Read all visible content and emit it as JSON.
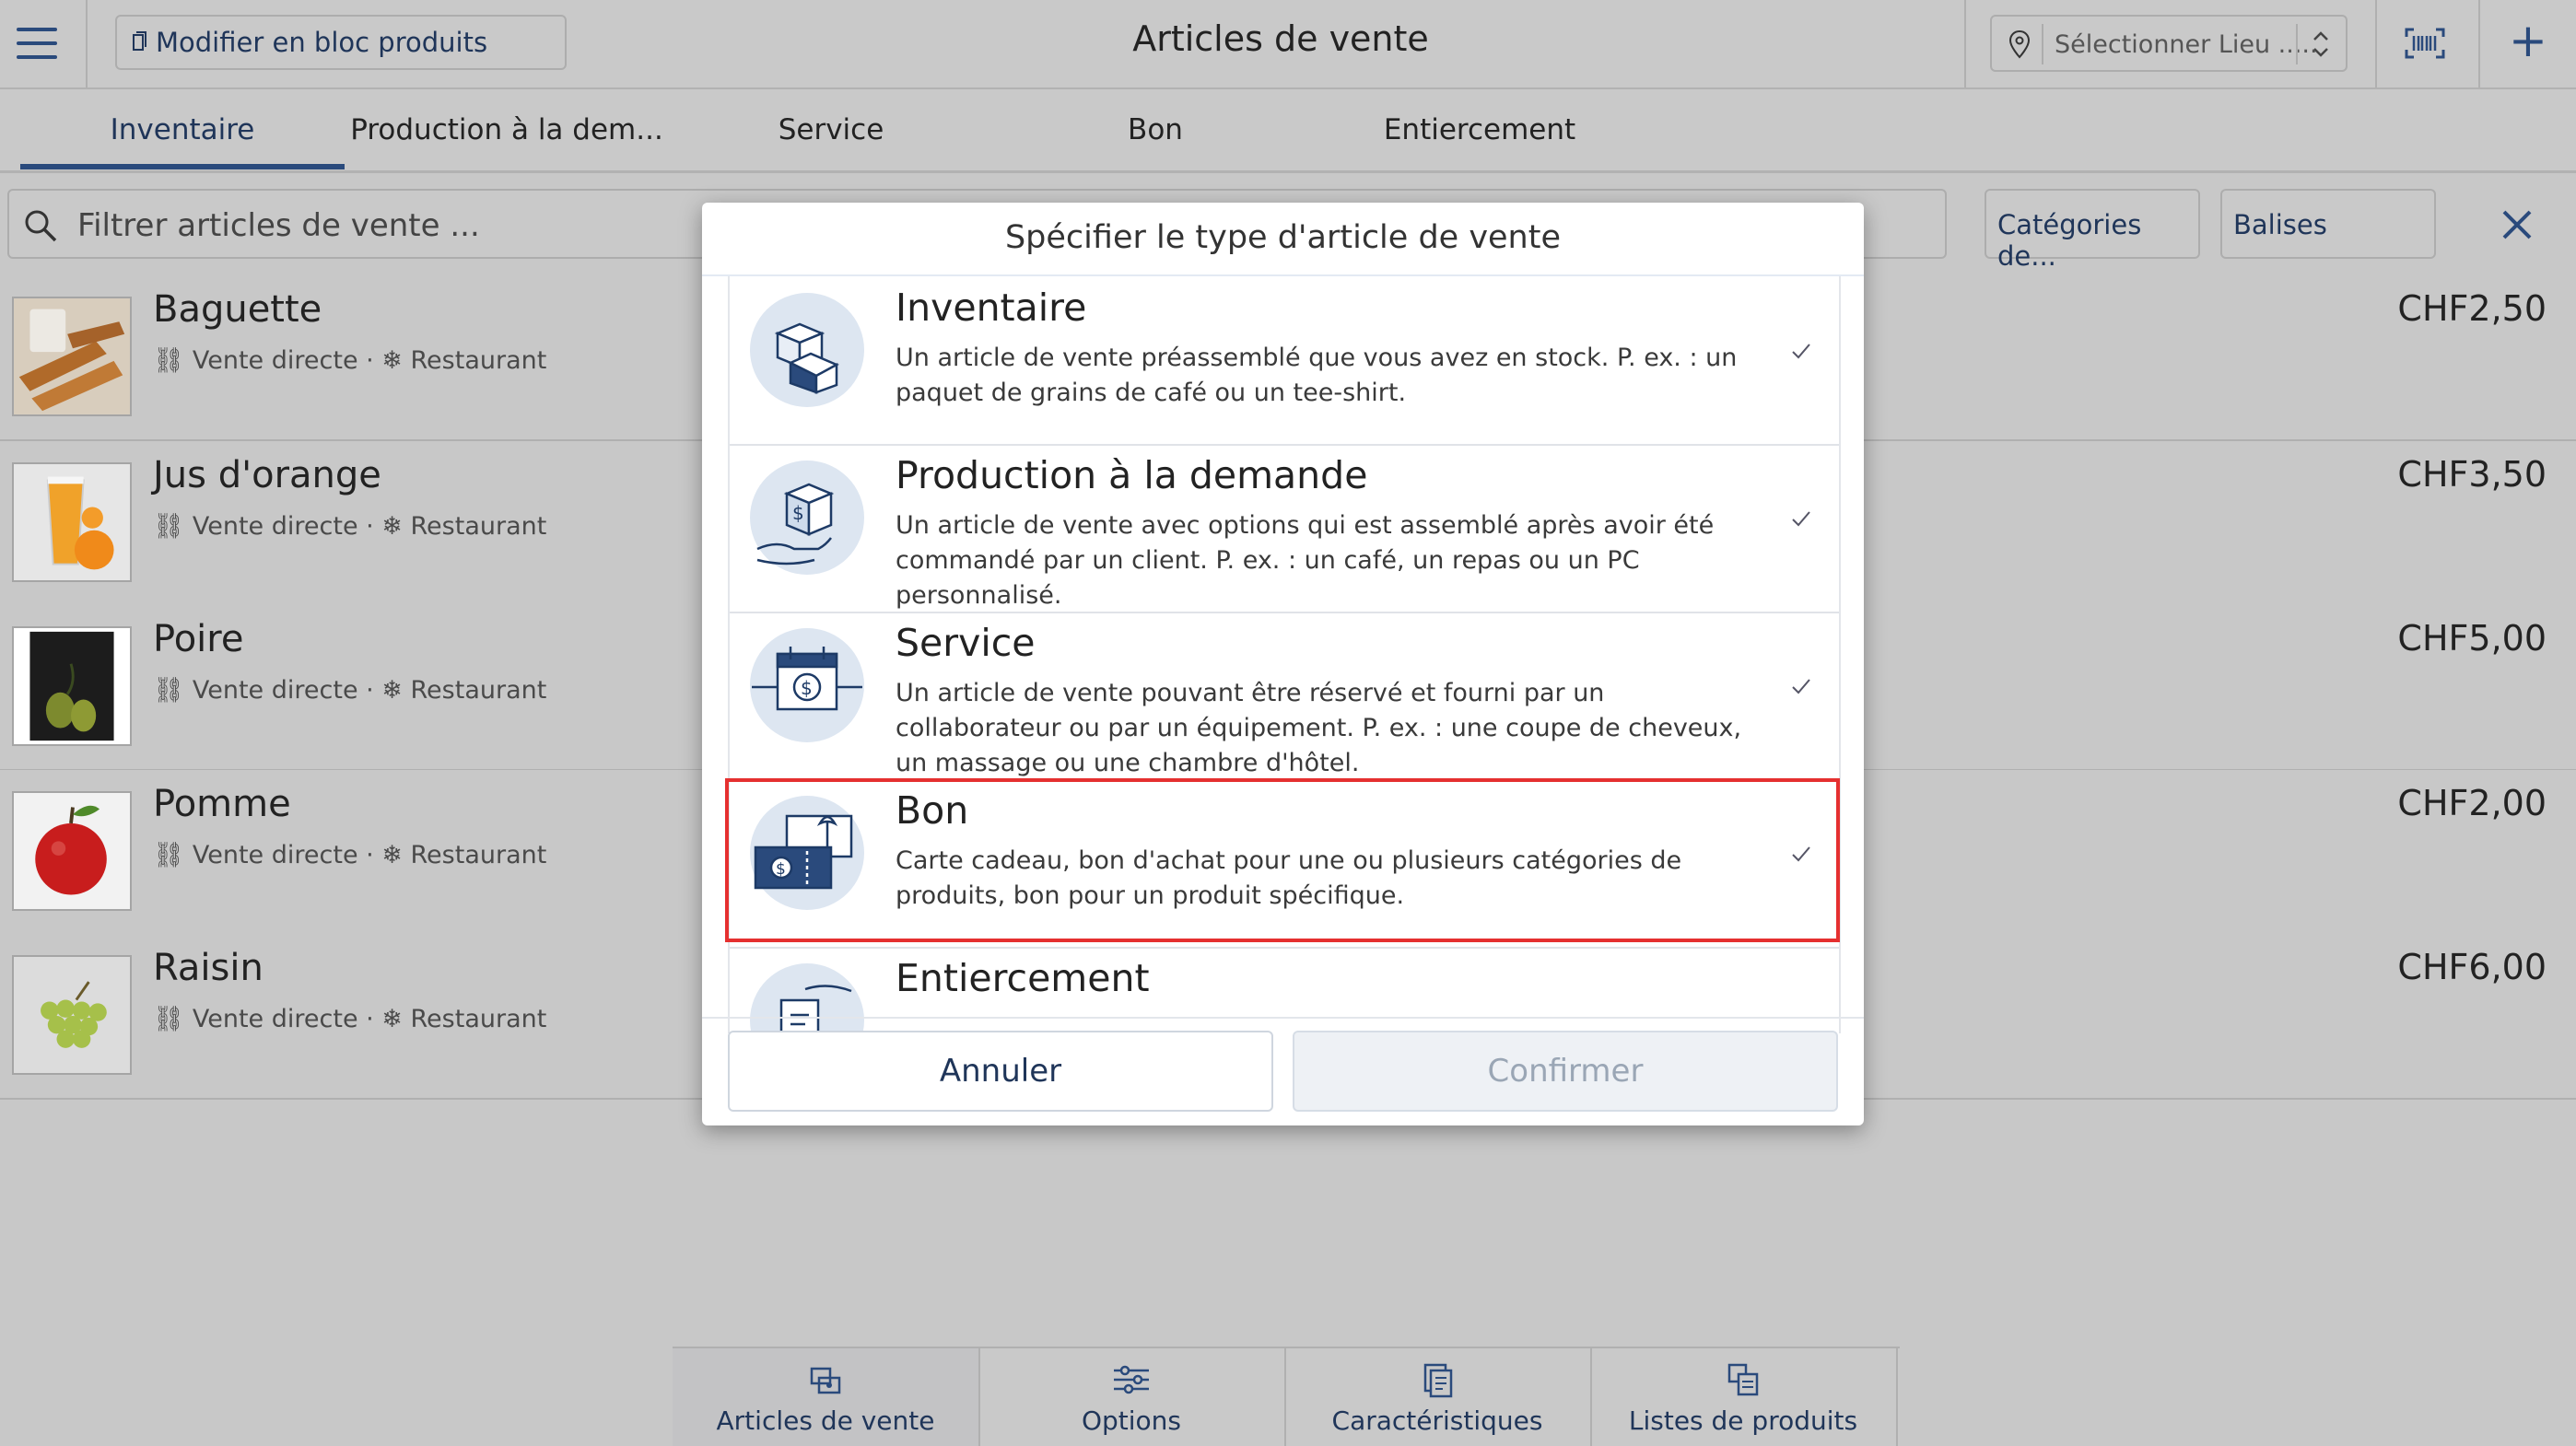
{
  "header": {
    "bulk_edit_label": "Modifier en bloc produits",
    "title": "Articles de vente",
    "location_placeholder": "Sélectionner Lieu .....",
    "menu_icon": "hamburger-icon",
    "barcode_icon": "barcode-icon",
    "add_icon": "plus-icon"
  },
  "tabs": [
    {
      "label": "Inventaire",
      "active": true
    },
    {
      "label": "Production à la dem...",
      "active": false
    },
    {
      "label": "Service",
      "active": false
    },
    {
      "label": "Bon",
      "active": false
    },
    {
      "label": "Entiercement",
      "active": false
    }
  ],
  "filter": {
    "placeholder": "Filtrer articles de vente ...",
    "categories_label": "Catégories de...",
    "tags_label": "Balises"
  },
  "items": [
    {
      "name": "Baguette",
      "meta": "Vente directe · ❄ Restaurant",
      "price": "CHF2,50"
    },
    {
      "name": "Jus d'orange",
      "meta": "Vente directe · ❄ Restaurant",
      "price": "CHF3,50"
    },
    {
      "name": "Poire",
      "meta": "Vente directe · ❄ Restaurant",
      "price": "CHF5,00"
    },
    {
      "name": "Pomme",
      "meta": "Vente directe · ❄ Restaurant",
      "price": "CHF2,00"
    },
    {
      "name": "Raisin",
      "meta": "Vente directe · ❄ Restaurant",
      "price": "CHF6,00"
    }
  ],
  "modal": {
    "title": "Spécifier le type d'article de vente",
    "options": [
      {
        "name": "Inventaire",
        "description": "Un article de vente préassemblé que vous avez en stock. P. ex. : un paquet de grains de café ou un tee-shirt.",
        "icon": "boxes-icon"
      },
      {
        "name": "Production à la demande",
        "description": "Un article de vente avec options qui est assemblé après avoir été commandé par un client. P. ex. : un café, un repas ou un PC personnalisé.",
        "icon": "hand-box-icon"
      },
      {
        "name": "Service",
        "description": "Un article de vente pouvant être réservé et fourni par un collaborateur ou par un équipement. P. ex. : une coupe de cheveux, un massage ou une chambre d'hôtel.",
        "icon": "calendar-dollar-icon"
      },
      {
        "name": "Bon",
        "description": "Carte cadeau, bon d'achat pour une ou plusieurs catégories de produits, bon pour un produit spécifique.",
        "icon": "voucher-icon",
        "highlighted": true
      },
      {
        "name": "Entiercement",
        "description": "",
        "icon": "escrow-icon"
      }
    ],
    "cancel_label": "Annuler",
    "confirm_label": "Confirmer"
  },
  "bottom_nav": [
    {
      "label": "Articles de vente",
      "active": true
    },
    {
      "label": "Options",
      "active": false
    },
    {
      "label": "Caractéristiques",
      "active": false
    },
    {
      "label": "Listes de produits",
      "active": false
    }
  ],
  "colors": {
    "accent": "#2a4a7c",
    "highlight_border": "#e53030",
    "dim_background": "#c8c8c8"
  }
}
